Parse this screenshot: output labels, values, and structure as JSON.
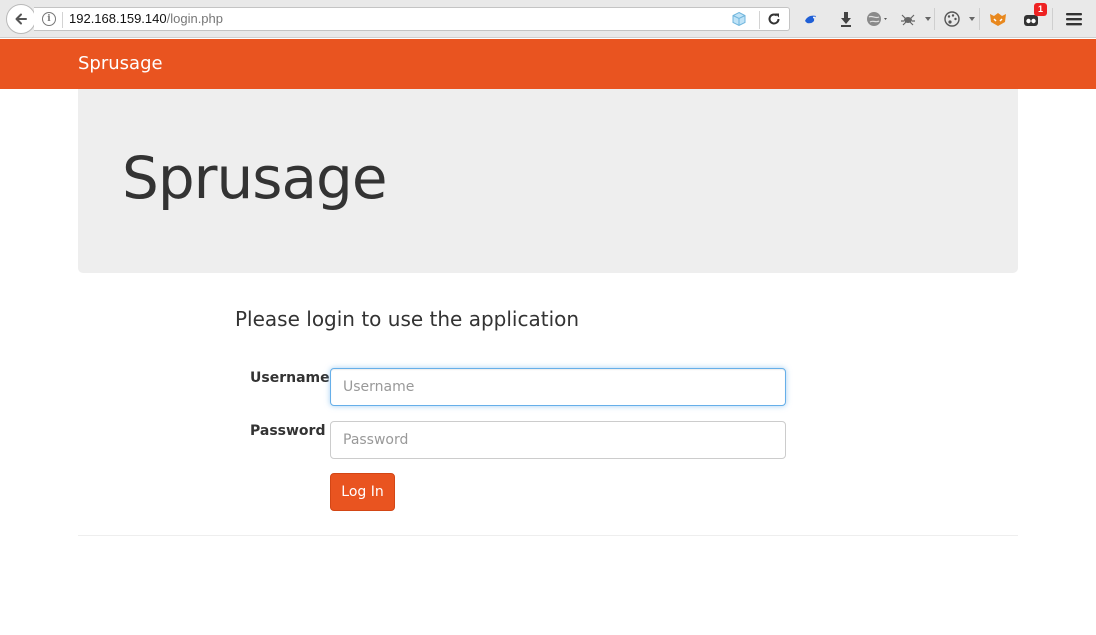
{
  "browser": {
    "url_host": "192.168.159.140",
    "url_path": "/login.php",
    "extension_badge": "1"
  },
  "navbar": {
    "brand": "Sprusage",
    "color": "#e95420"
  },
  "jumbotron": {
    "title": "Sprusage"
  },
  "login_form": {
    "heading": "Please login to use the application",
    "username_label": "Username",
    "username_placeholder": "Username",
    "username_value": "",
    "password_label": "Password",
    "password_placeholder": "Password",
    "password_value": "",
    "submit_label": "Log In"
  }
}
